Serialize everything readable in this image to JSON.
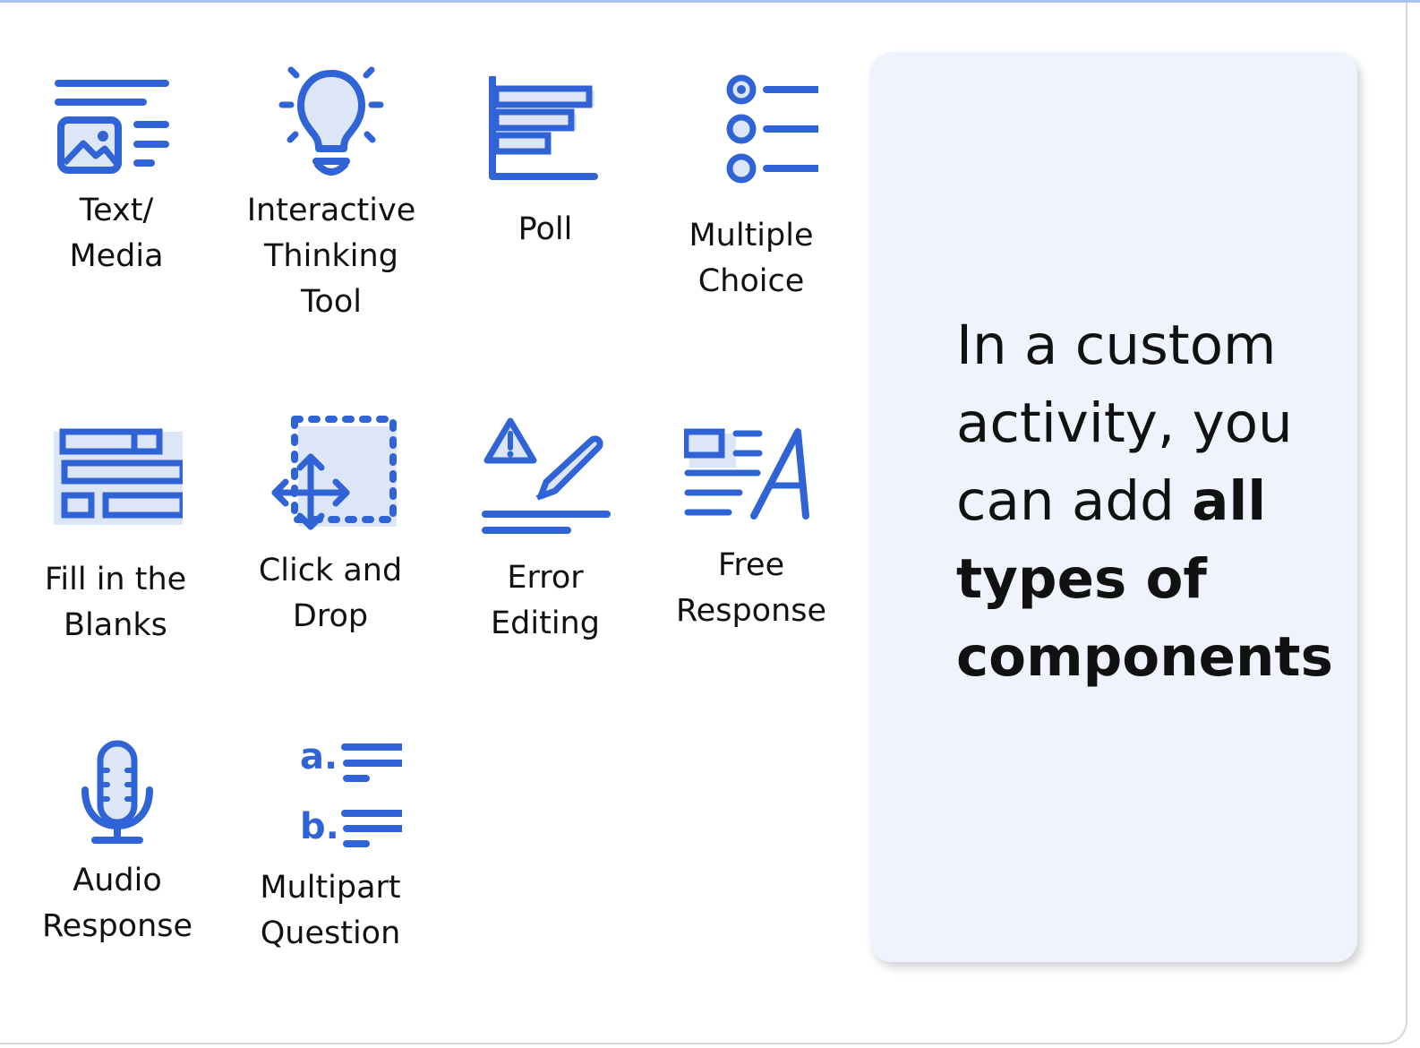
{
  "components": [
    {
      "label": "Text/\nMedia",
      "icon": "text-media-icon"
    },
    {
      "label": "Interactive\nThinking\nTool",
      "icon": "lightbulb-icon"
    },
    {
      "label": "Poll",
      "icon": "poll-icon"
    },
    {
      "label": "Multiple\nChoice",
      "icon": "multiple-choice-icon"
    },
    {
      "label": "Fill in the\nBlanks",
      "icon": "fill-in-blanks-icon"
    },
    {
      "label": "Click and\nDrop",
      "icon": "click-and-drop-icon"
    },
    {
      "label": "Error\nEditing",
      "icon": "error-editing-icon"
    },
    {
      "label": "Free\nResponse",
      "icon": "free-response-icon"
    },
    {
      "label": "Audio\nResponse",
      "icon": "microphone-icon"
    },
    {
      "label": "Multipart\nQuestion",
      "icon": "multipart-question-icon"
    }
  ],
  "callout": {
    "text_regular": "In a custom activity, you can add ",
    "text_bold": "all types of components"
  },
  "colors": {
    "icon_blue": "#2f63d6",
    "icon_fill": "#dde6f7",
    "callout_bg": "#eef3fe"
  }
}
